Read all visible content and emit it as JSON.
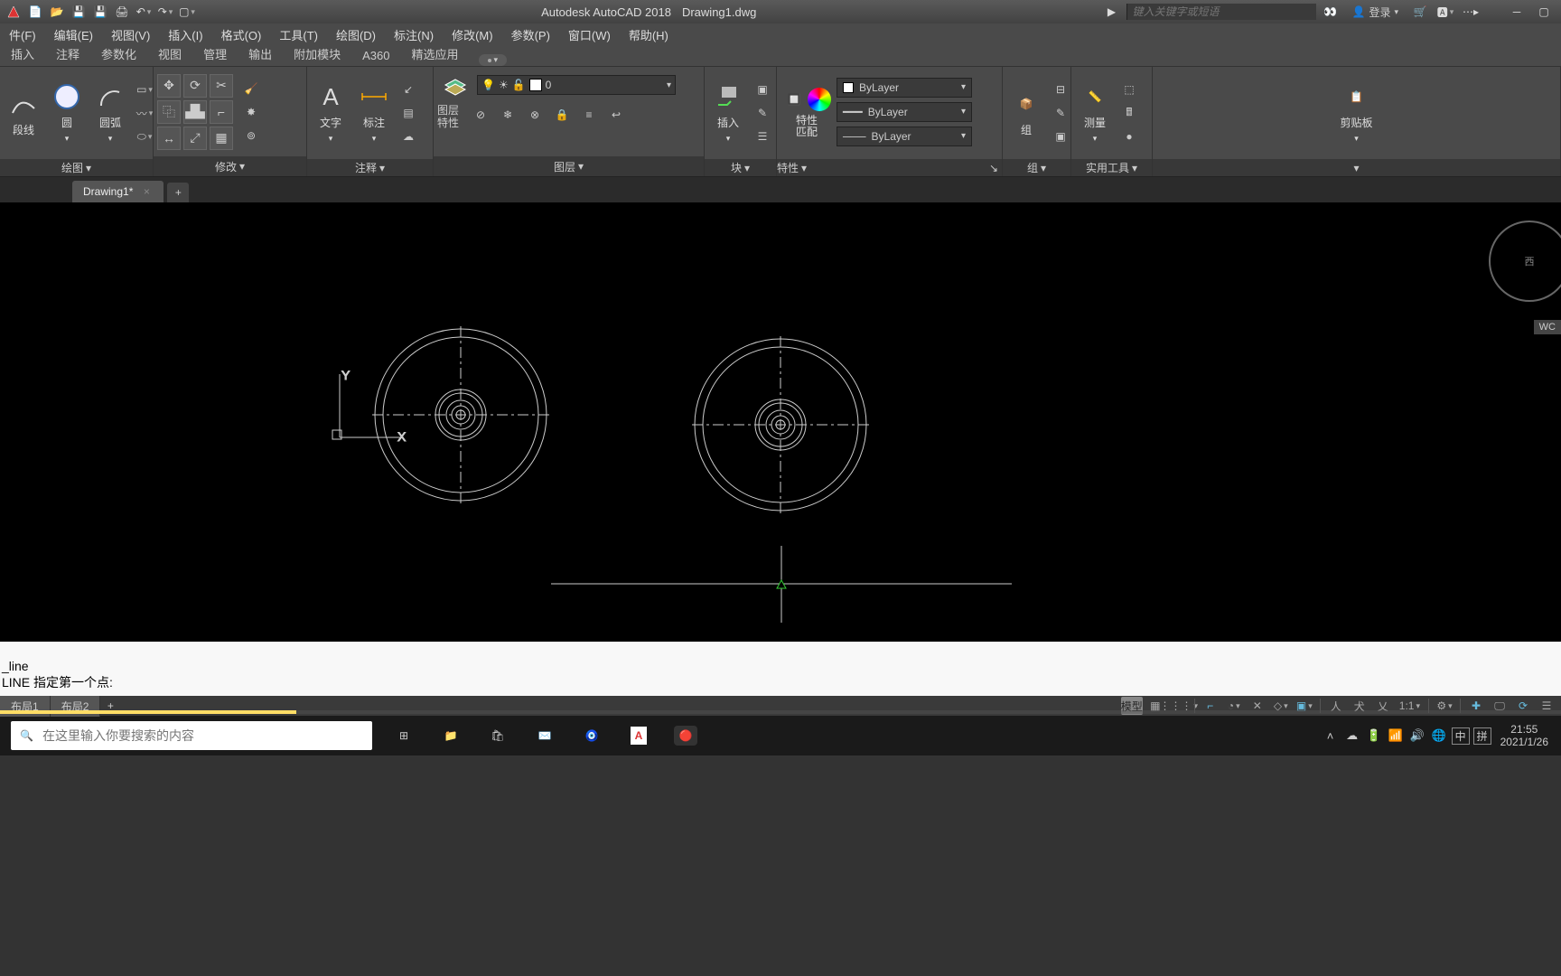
{
  "app": {
    "title": "Autodesk AutoCAD 2018",
    "filename": "Drawing1.dwg"
  },
  "search": {
    "placeholder": "键入关键字或短语"
  },
  "login_label": "登录",
  "menus": [
    "件(F)",
    "编辑(E)",
    "视图(V)",
    "插入(I)",
    "格式(O)",
    "工具(T)",
    "绘图(D)",
    "标注(N)",
    "修改(M)",
    "参数(P)",
    "窗口(W)",
    "帮助(H)"
  ],
  "ribbon_tabs": [
    "插入",
    "注释",
    "参数化",
    "视图",
    "管理",
    "输出",
    "附加模块",
    "A360",
    "精选应用"
  ],
  "panels": {
    "draw": {
      "title": "绘图",
      "circle": "圆",
      "arc": "圆弧",
      "pline": "段线"
    },
    "modify": {
      "title": "修改"
    },
    "annot": {
      "title": "注释",
      "text": "文字",
      "dim": "标注"
    },
    "layer": {
      "title": "图层",
      "props": "图层\n特性",
      "current": "0"
    },
    "block": {
      "title": "块",
      "insert": "插入"
    },
    "props": {
      "title": "特性",
      "match": "特性\n匹配",
      "bylayer": "ByLayer"
    },
    "group": {
      "title": "组",
      "label": "组"
    },
    "util": {
      "title": "实用工具",
      "measure": "测量"
    },
    "clip": {
      "title": "",
      "label": "剪贴板"
    }
  },
  "file_tab": "Drawing1*",
  "nav": {
    "compass": "西",
    "wcs": "WC"
  },
  "command": {
    "line1": "_line",
    "line2": "LINE 指定第一个点:"
  },
  "layouts": [
    "布局1",
    "布局2"
  ],
  "status": {
    "model": "模型",
    "scale": "1:1"
  },
  "taskbar": {
    "search_placeholder": "在这里输入你要搜索的内容",
    "ime1": "中",
    "ime2": "拼",
    "time": "21:55",
    "date": "2021/1/26"
  }
}
